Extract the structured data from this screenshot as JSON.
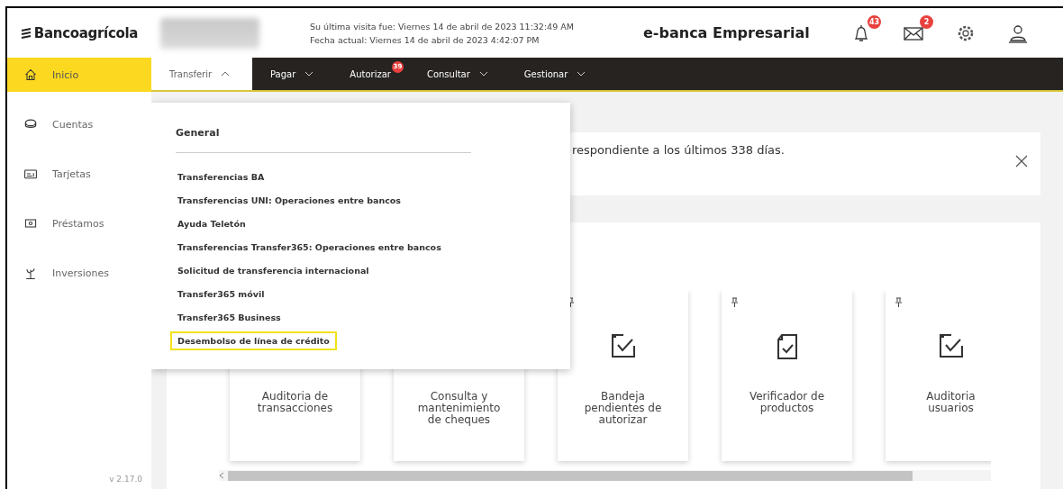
{
  "header": {
    "logo": "Bancoagrícola",
    "last_visit": "Su última visita fue: Viernes 14 de abril de 2023 11:32:49 AM",
    "current_date": "Fecha actual: Viernes 14 de abril de 2023 4:42:07 PM",
    "title": "e-banca Empresarial",
    "notifications_badge": "43",
    "messages_badge": "2"
  },
  "sidebar": {
    "items": [
      {
        "label": "Inicio",
        "kind": "home",
        "selected": true
      },
      {
        "label": "Cuentas",
        "kind": "accounts",
        "selected": false
      },
      {
        "label": "Tarjetas",
        "kind": "cards",
        "selected": false
      },
      {
        "label": "Préstamos",
        "kind": "loans",
        "selected": false
      },
      {
        "label": "Inversiones",
        "kind": "investments",
        "selected": false
      }
    ],
    "version": "v 2.17.0"
  },
  "nav": [
    {
      "label": "Transferir",
      "selected": true,
      "expanded": true
    },
    {
      "label": "Pagar",
      "selected": false,
      "expanded": false
    },
    {
      "label": "Autorizar",
      "selected": false,
      "badge": "39"
    },
    {
      "label": "Consultar",
      "selected": false,
      "expanded": false
    },
    {
      "label": "Gestionar",
      "selected": false,
      "expanded": false
    }
  ],
  "dropdown": {
    "heading": "General",
    "items": [
      {
        "label": "Transferencias BA",
        "highlighted": false
      },
      {
        "label": "Transferencias UNI: Operaciones entre bancos",
        "highlighted": false
      },
      {
        "label": "Ayuda Teletón",
        "highlighted": false
      },
      {
        "label": "Transferencias Transfer365: Operaciones entre bancos",
        "highlighted": false
      },
      {
        "label": "Solicitud de transferencia internacional",
        "highlighted": false
      },
      {
        "label": "Transfer365 móvil",
        "highlighted": false
      },
      {
        "label": "Transfer365 Business",
        "highlighted": false
      },
      {
        "label": "Desembolso de línea de crédito",
        "highlighted": true
      }
    ]
  },
  "banner": {
    "text": "respondiente a los últimos 338 días."
  },
  "cards": [
    {
      "lines": [
        "Auditoria de",
        "transacciones"
      ]
    },
    {
      "lines": [
        "Consulta y",
        "mantenimiento",
        "de cheques"
      ]
    },
    {
      "lines": [
        "Bandeja",
        "pendientes de",
        "autorizar"
      ],
      "kind": "task"
    },
    {
      "lines": [
        "Verificador de",
        "productos"
      ],
      "kind": "document"
    },
    {
      "lines": [
        "Auditoria",
        "usuarios"
      ],
      "kind": "task"
    }
  ]
}
